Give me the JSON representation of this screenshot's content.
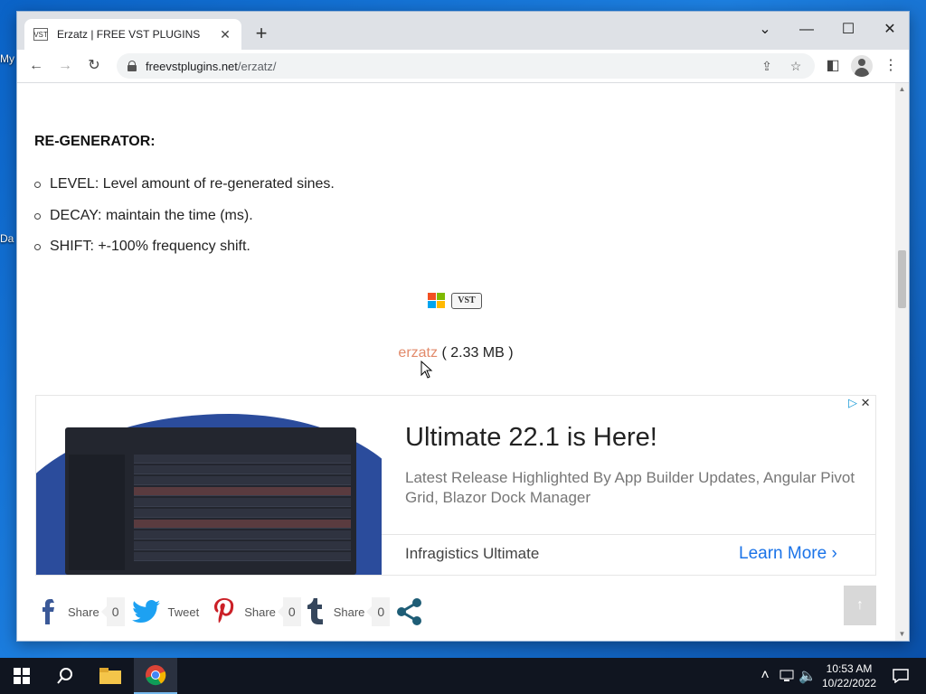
{
  "desktop": {
    "labels": [
      "My",
      "Da"
    ]
  },
  "browser": {
    "tab_title": "Erzatz | FREE VST PLUGINS",
    "tab_favicon": "VST",
    "url_host": "freevstplugins.net",
    "url_path": "/erzatz/"
  },
  "page": {
    "section_heading": "RE-GENERATOR:",
    "params": [
      {
        "text": "LEVEL: Level amount of re-generated sines."
      },
      {
        "text": "DECAY: maintain the time (ms)."
      },
      {
        "text": "SHIFT: +-100% frequency shift."
      }
    ],
    "download": {
      "link": "erzatz",
      "size": " ( 2.33 MB )"
    },
    "vst_badge": "VST"
  },
  "ad": {
    "headline": "Ultimate 22.1 is Here!",
    "description": "Latest Release Highlighted By App Builder Updates, Angular Pivot Grid, Blazor Dock Manager",
    "brand": "Infragistics Ultimate",
    "cta": "Learn More",
    "badge_icons": [
      "adchoices-icon",
      "close-icon"
    ]
  },
  "share": [
    {
      "network": "facebook",
      "label": "Share",
      "count": "0",
      "color": "#3b5998"
    },
    {
      "network": "twitter",
      "label": "Tweet",
      "count": "",
      "color": "#1da1f2"
    },
    {
      "network": "pinterest",
      "label": "Share",
      "count": "0",
      "color": "#cb2027"
    },
    {
      "network": "tumblr",
      "label": "Share",
      "count": "0",
      "color": "#35465c"
    }
  ],
  "taskbar": {
    "time": "10:53 AM",
    "date": "10/22/2022"
  },
  "colors": {
    "link": "#e28a6a",
    "ad_cta": "#1a73e8",
    "share_icon": "#1e5d76"
  }
}
